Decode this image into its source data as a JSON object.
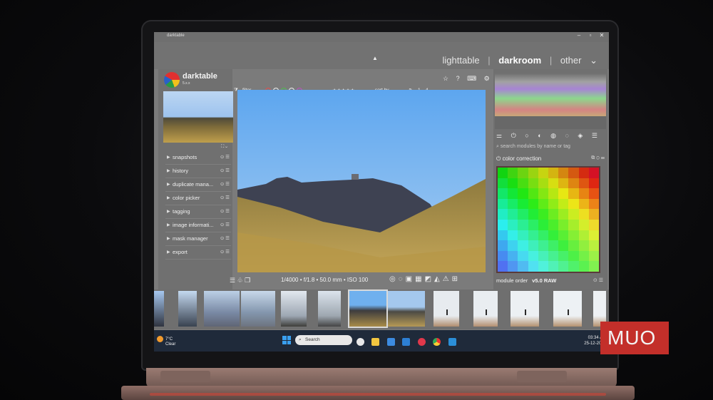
{
  "window": {
    "title": "darktable",
    "controls": [
      "‒",
      "▫",
      "✕"
    ]
  },
  "views": {
    "lighttable": "lighttable",
    "darkroom": "darkroom",
    "other": "other",
    "sep": "|",
    "expand": "⌄"
  },
  "app": {
    "name": "darktable",
    "version": "5.x.x"
  },
  "left_modules": [
    {
      "label": "snapshots"
    },
    {
      "label": "history"
    },
    {
      "label": "duplicate mana..."
    },
    {
      "label": "color picker"
    },
    {
      "label": "tagging"
    },
    {
      "label": "image informati..."
    },
    {
      "label": "mask manager"
    },
    {
      "label": "export"
    }
  ],
  "filterbar": {
    "filter_label": "filter",
    "sort_label": "sort by",
    "count": "1 .. 4",
    "stars": "★★★★★"
  },
  "toolbar_right": [
    "☆",
    "?",
    "⌨",
    "⚙"
  ],
  "image_info": "1/4000 • f/1.8 • 50.0 mm • ISO 100",
  "right_panel": {
    "search_placeholder": "search modules by name or tag",
    "active_module": "color correction",
    "module_order_label": "module order",
    "module_order_value": "v5.0 RAW"
  },
  "taskbar": {
    "temperature": "7°C",
    "weather": "Clear",
    "search": "Search",
    "time": "03:34 AM",
    "date": "25-12-2025"
  },
  "brand": "MUO",
  "colors": {
    "accent": "#c32f2a",
    "panel": "#707070",
    "taskbar": "#1f2a3a"
  }
}
